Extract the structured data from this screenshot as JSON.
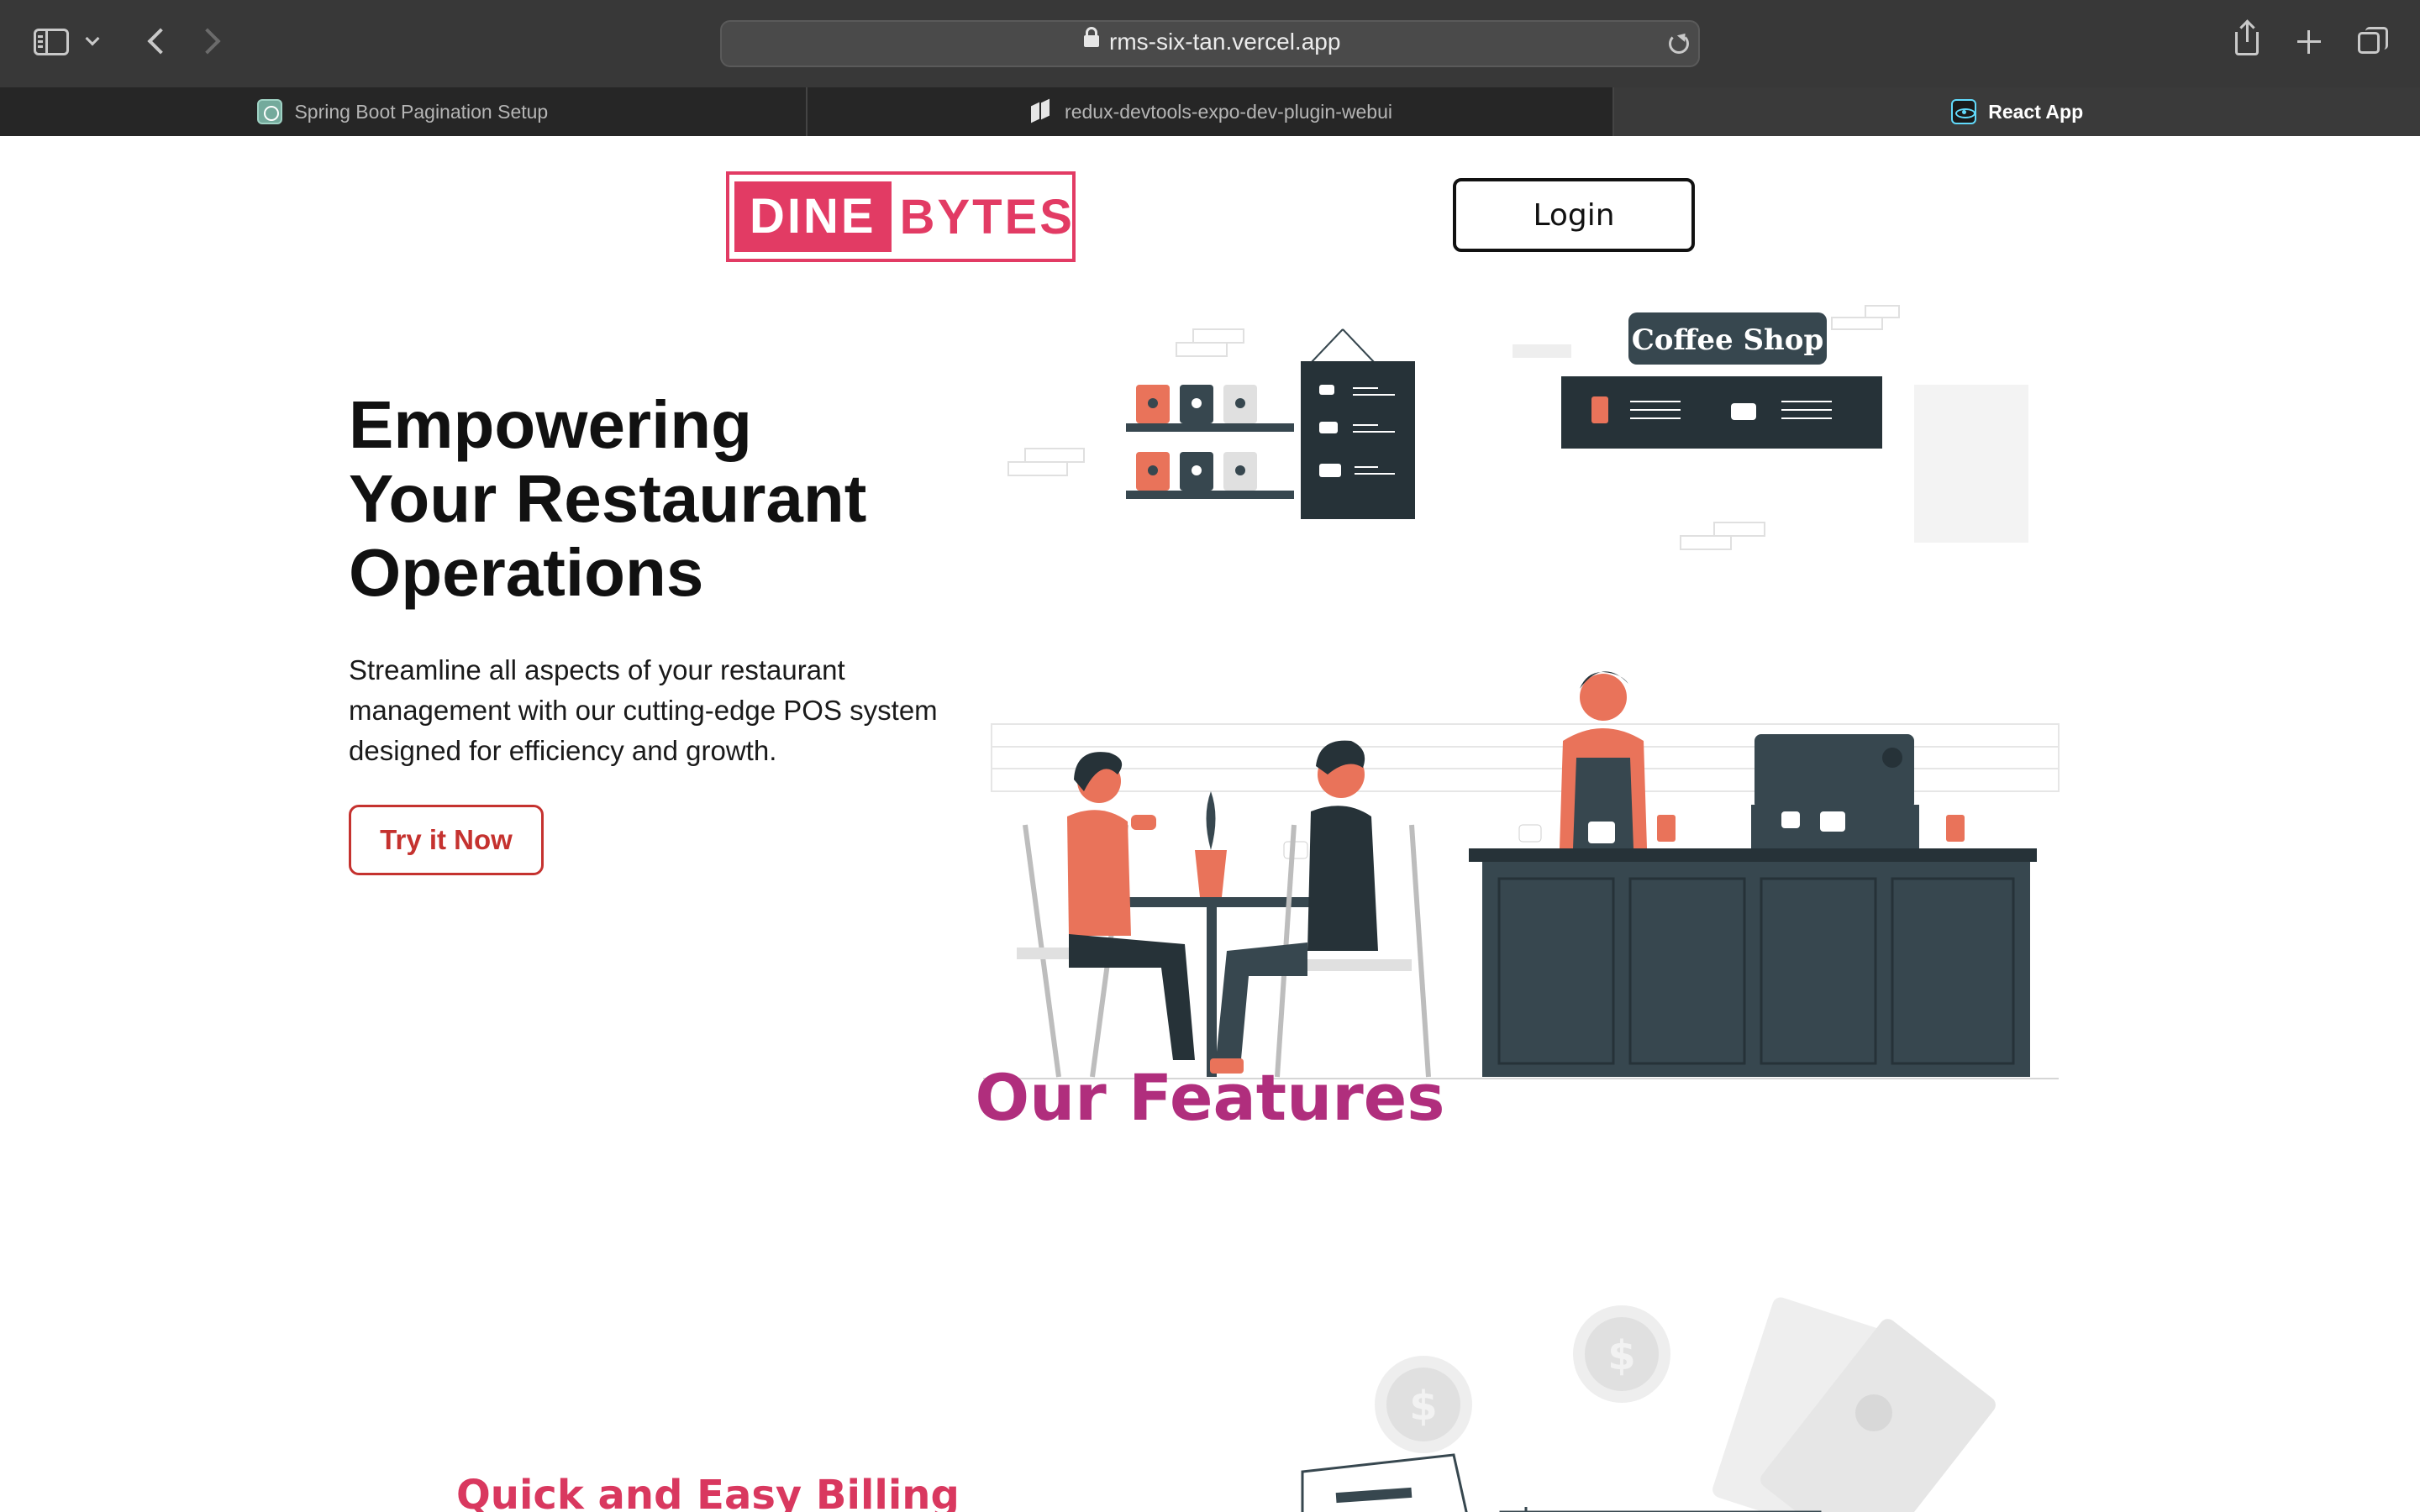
{
  "browser": {
    "url": "rms-six-tan.vercel.app",
    "tabs": [
      {
        "label": "Spring Boot Pagination Setup",
        "icon": "chatgpt-icon",
        "active": false
      },
      {
        "label": "redux-devtools-expo-dev-plugin-webui",
        "icon": "repo-icon",
        "active": false
      },
      {
        "label": "React App",
        "icon": "react-icon",
        "active": true
      }
    ]
  },
  "header": {
    "logo_part1": "DINE",
    "logo_part2": "BYTES",
    "login_label": "Login"
  },
  "hero": {
    "title_line1": "Empowering",
    "title_line2": "Your Restaurant",
    "title_line3": "Operations",
    "description": "Streamline all aspects of your restaurant management with our cutting-edge POS system designed for efficiency and growth.",
    "cta_label": "Try it Now",
    "illustration_sign": "Coffee Shop"
  },
  "features": {
    "title": "Our Features",
    "first_feature_title": "Quick and Easy Billing"
  },
  "colors": {
    "brand_pink": "#e23b64",
    "features_purple": "#b02e7d",
    "cta_red": "#c5322f",
    "illus_dark": "#37474f",
    "illus_coral": "#e9735a"
  }
}
